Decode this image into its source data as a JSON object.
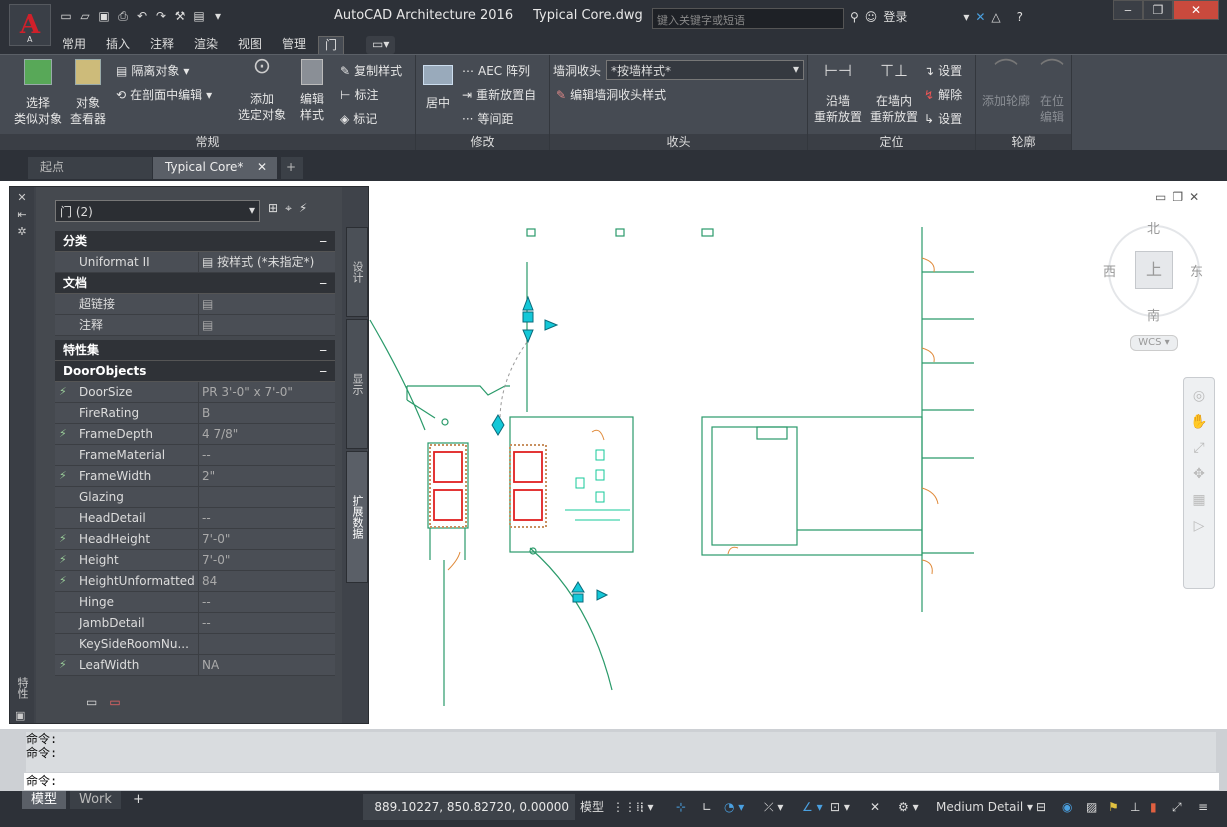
{
  "title": {
    "app": "AutoCAD Architecture 2016",
    "file": "Typical Core.dwg",
    "app_button_sub": "A"
  },
  "search": {
    "placeholder": "键入关键字或短语"
  },
  "login": {
    "label": "登录"
  },
  "ribbon_tabs": [
    "常用",
    "插入",
    "注释",
    "渲染",
    "视图",
    "管理",
    "门"
  ],
  "ribbon": {
    "changgui": {
      "label": "常规",
      "select_similar": [
        "选择",
        "类似对象"
      ],
      "object_viewer": [
        "对象",
        "查看器"
      ],
      "isolate": "隔离对象",
      "edit_in_section": "在剖面中编辑",
      "add_selected": [
        "添加",
        "选定对象"
      ],
      "edit_style": [
        "编辑",
        "样式"
      ],
      "copy_style": "复制样式",
      "annotate": "标注",
      "tag": "标记"
    },
    "modify": {
      "label": "修改",
      "center": "居中",
      "aec_array": "AEC 阵列",
      "reposition": "重新放置自",
      "equal_spacing": "等间距"
    },
    "endcap": {
      "label": "收头",
      "wall_endcap": "墙洞收头",
      "endcap_value": "*按墙样式*",
      "edit_endcap": "编辑墙洞收头样式"
    },
    "position": {
      "label": "定位",
      "along_wall": [
        "沿墙",
        "重新放置"
      ],
      "in_wall": [
        "在墙内",
        "重新放置"
      ],
      "setting1": "设置",
      "release": "解除",
      "setting2": "设置"
    },
    "profile": {
      "label": "轮廓",
      "add_profile": "添加轮廓",
      "in_place": [
        "在位",
        "编辑"
      ]
    }
  },
  "doc_tabs": {
    "start": "起点",
    "current": "Typical Core*"
  },
  "properties": {
    "selector": "门 (2)",
    "side_label": "特性",
    "tabs": [
      "设计",
      "显示",
      "扩展数据"
    ],
    "sections": {
      "classification": "分类",
      "documents": "文档",
      "property_sets": "特性集",
      "door_objects": "DoorObjects"
    },
    "classification_rows": [
      {
        "key": "Uniformat II",
        "value": "按样式 (*未指定*)"
      }
    ],
    "document_rows": [
      {
        "key": "超链接",
        "value": ""
      },
      {
        "key": "注释",
        "value": ""
      }
    ],
    "door_rows": [
      {
        "key": "DoorSize",
        "value": "PR 3'-0\" x 7'-0\"",
        "bolt": true
      },
      {
        "key": "FireRating",
        "value": "B",
        "bolt": false
      },
      {
        "key": "FrameDepth",
        "value": "4 7/8\"",
        "bolt": true
      },
      {
        "key": "FrameMaterial",
        "value": "--",
        "bolt": false
      },
      {
        "key": "FrameWidth",
        "value": "2\"",
        "bolt": true
      },
      {
        "key": "Glazing",
        "value": "",
        "bolt": false
      },
      {
        "key": "HeadDetail",
        "value": "--",
        "bolt": false
      },
      {
        "key": "HeadHeight",
        "value": "7'-0\"",
        "bolt": true
      },
      {
        "key": "Height",
        "value": "7'-0\"",
        "bolt": true
      },
      {
        "key": "HeightUnformatted",
        "value": "84",
        "bolt": true
      },
      {
        "key": "Hinge",
        "value": "--",
        "bolt": false
      },
      {
        "key": "JambDetail",
        "value": "--",
        "bolt": false
      },
      {
        "key": "KeySideRoomNu...",
        "value": "",
        "bolt": false
      },
      {
        "key": "LeafWidth",
        "value": "NA",
        "bolt": true
      }
    ]
  },
  "viewcube": {
    "north": "北",
    "south": "南",
    "east": "东",
    "west": "西",
    "top": "上",
    "wcs": "WCS"
  },
  "command": {
    "history": [
      "命令:",
      "命令:"
    ],
    "prompt": "命令:"
  },
  "status": {
    "layout_model": "模型",
    "layout_work": "Work",
    "coords": "889.10227, 850.82720, 0.00000",
    "space": "模型",
    "detail": "Medium Detail"
  },
  "colors": {
    "accent_tab": "#4a90d0",
    "door_red": "#e02020",
    "wall_green": "#2a9a6a",
    "select_cyan": "#14c8d8"
  }
}
